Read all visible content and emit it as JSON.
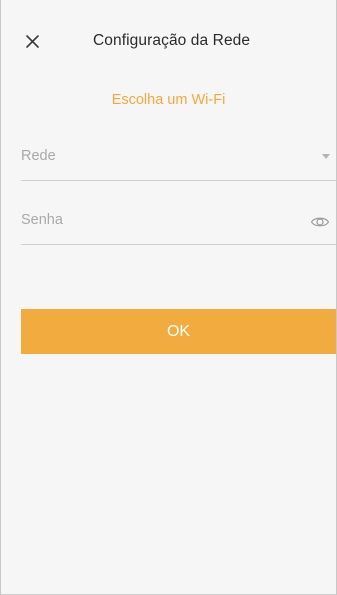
{
  "header": {
    "title": "Configuração da Rede",
    "close_icon": "close-icon"
  },
  "subtitle": "Escolha um Wi-Fi",
  "form": {
    "network": {
      "placeholder": "Rede",
      "icon": "chevron-down-icon"
    },
    "password": {
      "placeholder": "Senha",
      "icon": "eye-icon"
    }
  },
  "ok_button": {
    "label": "OK"
  },
  "colors": {
    "accent": "#f2ab3e",
    "subtitle": "#f2a93b",
    "background": "#f6f6f6",
    "placeholder": "#a9a9a9"
  }
}
